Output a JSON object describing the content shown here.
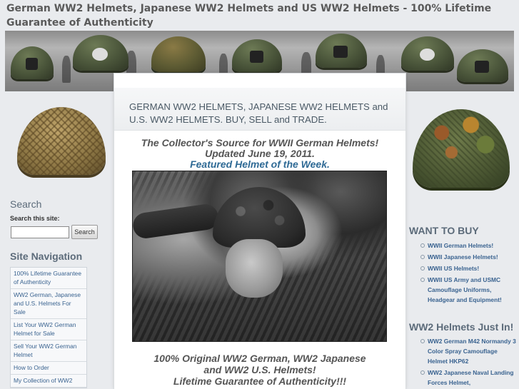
{
  "site": {
    "title": "German WW2 Helmets, Japanese WW2 Helmets and US WW2 Helmets - 100% Lifetime Guarantee of Authenticity"
  },
  "search": {
    "heading": "Search",
    "label": "Search this site:",
    "input_value": "",
    "button_label": "Search"
  },
  "navigation": {
    "heading": "Site Navigation",
    "items": [
      {
        "label": "100% Lifetime Guarantee of Authenticity"
      },
      {
        "label": "WW2 German, Japanese and U.S. Helmets For Sale"
      },
      {
        "label": "List Your WW2 German Helmet for Sale"
      },
      {
        "label": "Sell Your WW2 German Helmet"
      },
      {
        "label": "How to Order"
      },
      {
        "label": "My Collection of WW2"
      }
    ]
  },
  "main": {
    "subtitle": "GERMAN WW2 HELMETS, JAPANESE WW2 HELMETS and U.S. WW2 HELMETS. BUY, SELL and TRADE.",
    "tagline_line1": "The Collector's Source for WWII German Helmets!",
    "tagline_line2": "Updated June 19, 2011.",
    "featured_link": "Featured Helmet of the Week.",
    "bottom_line1": "100% Original WW2 German, WW2 Japanese",
    "bottom_line2": "and WW2 U.S. Helmets!",
    "bottom_line3": "Lifetime Guarantee of Authenticity!!!"
  },
  "want_to_buy": {
    "heading": "WANT TO BUY",
    "items": [
      {
        "label": "WWII German Helmets!"
      },
      {
        "label": "WWII Japanese Helmets!"
      },
      {
        "label": "WWII US Helmets!"
      },
      {
        "label": "WWII US Army and USMC Camouflage Uniforms, Headgear and Equipment!"
      }
    ]
  },
  "just_in": {
    "heading": "WW2 Helmets Just In!",
    "items": [
      {
        "label": "WW2 German M42 Normandy 3 Color Spray Camouflage Helmet HKP62"
      },
      {
        "label": "WW2 Japanese Naval Landing Forces Helmet,"
      }
    ]
  },
  "colors": {
    "page_background": "#e9ebee",
    "heading_text": "#5c6b7a",
    "link": "#3a6390",
    "featured_link": "#2f6a95"
  }
}
